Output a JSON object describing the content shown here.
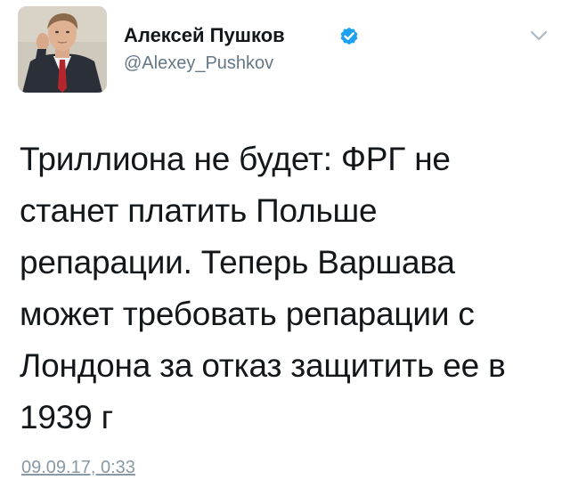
{
  "author": {
    "display_name": "Алексей Пушков",
    "handle": "@Alexey_Pushkov",
    "verified": true
  },
  "icons": {
    "verified": "verified-badge-icon",
    "menu": "chevron-down-icon"
  },
  "colors": {
    "verified_blue": "#1da1f2",
    "handle_gray": "#657786",
    "timestamp_gray": "#8899a6",
    "chevron_gray": "#aab8c2"
  },
  "tweet": {
    "text": "Триллиона не будет: ФРГ не\nстанет платить Польше\nрепарации. Теперь Варшава\nможет требовать репарации с\nЛондона за отказ защитить ее в\n1939 г",
    "timestamp": "09.09.17, 0:33"
  }
}
